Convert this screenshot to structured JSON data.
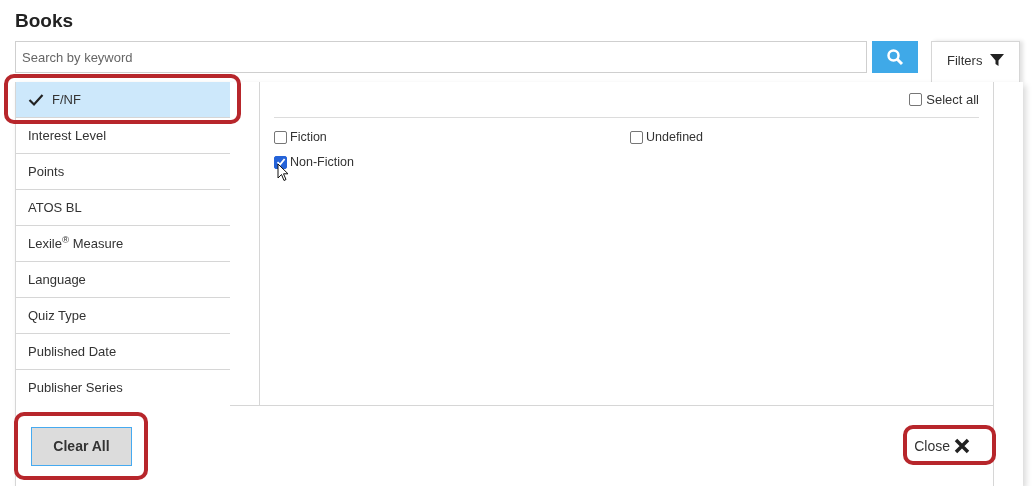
{
  "title": "Books",
  "search": {
    "placeholder": "Search by keyword"
  },
  "filters_tab": {
    "label": "Filters",
    "selected": true
  },
  "categories": [
    {
      "label": "F/NF",
      "selected": true,
      "applied": true
    },
    {
      "label": "Interest Level",
      "selected": false,
      "applied": false
    },
    {
      "label": "Points",
      "selected": false,
      "applied": false
    },
    {
      "label": "ATOS BL",
      "selected": false,
      "applied": false
    },
    {
      "label": "Lexile$^{®}$ Measure",
      "selected": false,
      "applied": false
    },
    {
      "label": "Language",
      "selected": false,
      "applied": false
    },
    {
      "label": "Quiz Type",
      "selected": false,
      "applied": false
    },
    {
      "label": "Published Date",
      "selected": false,
      "applied": false
    },
    {
      "label": "Publisher Series",
      "selected": false,
      "applied": false
    }
  ],
  "select_all": {
    "label": "Select all",
    "checked": false
  },
  "options": [
    {
      "label": "Fiction",
      "checked": false
    },
    {
      "label": "Undefined",
      "checked": false
    },
    {
      "label": "Non-Fiction",
      "checked": true
    }
  ],
  "buttons": {
    "clear": "Clear All",
    "close": "Close"
  }
}
